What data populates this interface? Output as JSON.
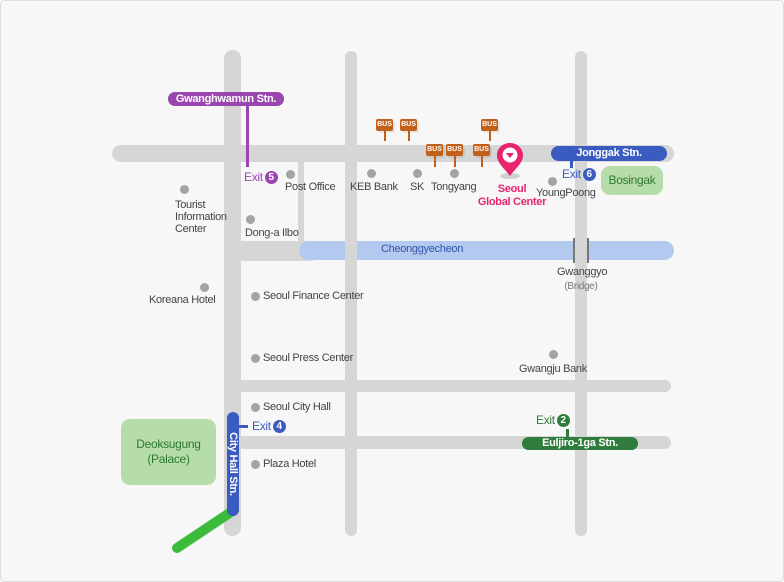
{
  "colors": {
    "road": "#d6d6d6",
    "stream": "#b4c9ef",
    "line_purple": "#9b45b0",
    "line_blue": "#3a5bbf",
    "line_green": "#2f7d3c",
    "line_light_green": "#3dbb3d",
    "destination_pink": "#e8246e",
    "bus_orange": "#c2601a",
    "park_green": "#b6dcaa"
  },
  "stations": {
    "gwanghwamun": {
      "label": "Gwanghwamun Stn.",
      "color": "#9b45b0"
    },
    "jonggak": {
      "label": "Jonggak Stn.",
      "color": "#3a5bbf"
    },
    "city_hall": {
      "label": "City Hall Stn.",
      "color": "#3a5bbf"
    },
    "euljiro": {
      "label": "Euljiro-1ga Stn.",
      "color": "#2f7d3c"
    }
  },
  "exits": {
    "exit5": {
      "label": "Exit",
      "number": "5"
    },
    "exit6": {
      "label": "Exit",
      "number": "6"
    },
    "exit4": {
      "label": "Exit",
      "number": "4"
    },
    "exit2": {
      "label": "Exit",
      "number": "2"
    }
  },
  "destination": {
    "line1": "Seoul",
    "line2": "Global Center",
    "icon": "location-pin-icon"
  },
  "bus_stop": {
    "label": "BUS",
    "icon": "bus-stop-icon",
    "count": 6
  },
  "stream": {
    "label": "Cheonggyecheon"
  },
  "bridge": {
    "name": "Gwanggyo",
    "note": "(Bridge)"
  },
  "parks": {
    "deoksugung": {
      "line1": "Deoksugung",
      "line2": "(Palace)"
    },
    "bosingak": {
      "label": "Bosingak"
    }
  },
  "landmarks": [
    {
      "label": "Post Office"
    },
    {
      "label": "KEB Bank"
    },
    {
      "label": "SK"
    },
    {
      "label": "Tongyang"
    },
    {
      "label": "YoungPoong"
    },
    {
      "line1": "Tourist",
      "line2": "Information",
      "line3": "Center"
    },
    {
      "label": "Dong-a Ilbo"
    },
    {
      "label": "Koreana Hotel"
    },
    {
      "label": "Seoul Finance Center"
    },
    {
      "label": "Seoul Press Center"
    },
    {
      "label": "Seoul City Hall"
    },
    {
      "label": "Plaza Hotel"
    },
    {
      "label": "Gwangju Bank"
    }
  ]
}
